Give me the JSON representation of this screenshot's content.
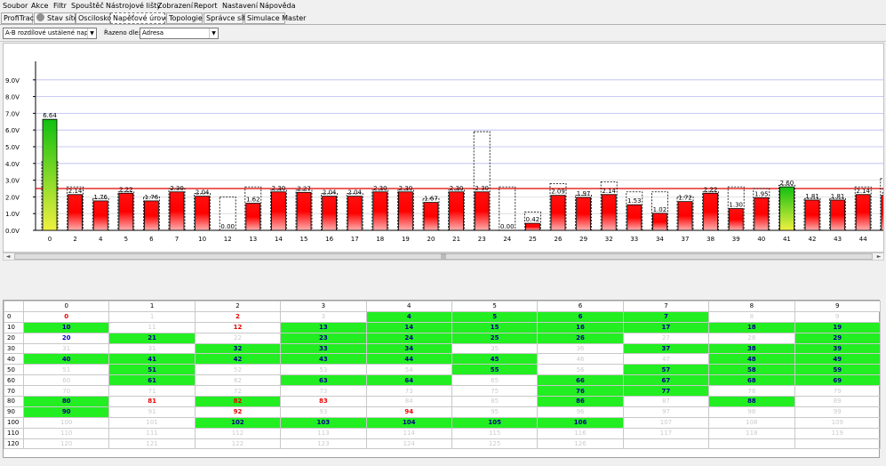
{
  "menu": [
    "Soubor",
    "Akce",
    "Filtr",
    "Spouštěč",
    "Nástrojové lišty",
    "Zobrazení",
    "Report",
    "Nastavení",
    "Nápověda"
  ],
  "tabs": [
    "ProfiTrace",
    "Stav sítě",
    "Osciloskop",
    "Napěťové úrovně",
    "Topologie",
    "Správce sítě",
    "Simulace Master"
  ],
  "toolbar": {
    "measure_value": "A-B rozdílové ustálené napětí",
    "sort_label": "Řazeno dle:",
    "sort_value": "Adresa"
  },
  "colors": {
    "bar_red": "#ff0000",
    "bar_green": "#00c000",
    "threshold_line": "#e00000",
    "grid_green": "#22ee22"
  },
  "chart_data": {
    "type": "bar",
    "ylabel": "",
    "ylim": [
      0,
      10
    ],
    "yticks": [
      "0.0V",
      "1.0V",
      "2.0V",
      "3.0V",
      "4.0V",
      "5.0V",
      "6.0V",
      "7.0V",
      "8.0V",
      "9.0V"
    ],
    "threshold": 2.5,
    "categories": [
      "0",
      "2",
      "4",
      "5",
      "6",
      "7",
      "10",
      "12",
      "13",
      "14",
      "15",
      "16",
      "17",
      "18",
      "19",
      "20",
      "21",
      "23",
      "24",
      "25",
      "26",
      "29",
      "32",
      "33",
      "34",
      "37",
      "38",
      "39",
      "40",
      "41",
      "42",
      "43",
      "44",
      "45"
    ],
    "values": [
      6.64,
      2.14,
      1.76,
      2.22,
      1.76,
      2.3,
      2.04,
      0.0,
      1.62,
      2.3,
      2.27,
      2.04,
      2.04,
      2.3,
      2.3,
      1.67,
      2.3,
      2.3,
      0.0,
      0.42,
      2.09,
      1.97,
      2.14,
      1.53,
      1.02,
      1.72,
      2.22,
      1.3,
      1.95,
      2.6,
      1.81,
      1.81,
      2.14,
      2.09
    ],
    "labels": [
      "6.64",
      "2.14",
      "1.76",
      "2.22",
      "1.76",
      "2.30",
      "2.04",
      "0.00",
      "1.62",
      "2.30",
      "2.27",
      "2.04",
      "2.04",
      "2.30",
      "2.30",
      "1.67",
      "2.30",
      "2.30",
      "0.00",
      "0.42",
      "2.09",
      "1.97",
      "2.14",
      "1.53",
      "1.02",
      "1.72",
      "2.22",
      "1.30",
      "1.95",
      "2.60",
      "1.81",
      "1.81",
      "2.14",
      "2.09"
    ],
    "peaks": [
      4.1,
      2.6,
      1.9,
      2.3,
      2.0,
      2.5,
      2.2,
      2.0,
      2.6,
      2.4,
      2.4,
      2.2,
      2.2,
      2.4,
      2.4,
      1.9,
      2.4,
      5.9,
      2.6,
      1.1,
      2.8,
      2.1,
      2.9,
      2.3,
      2.3,
      2.0,
      2.3,
      2.6,
      2.5,
      2.7,
      1.9,
      1.9,
      2.6,
      3.1
    ],
    "bar_colors": [
      "green",
      "red",
      "red",
      "red",
      "red",
      "red",
      "red",
      "red",
      "red",
      "red",
      "red",
      "red",
      "red",
      "red",
      "red",
      "red",
      "red",
      "red",
      "red",
      "red",
      "red",
      "red",
      "red",
      "red",
      "red",
      "red",
      "red",
      "red",
      "red",
      "green",
      "red",
      "red",
      "red",
      "red"
    ]
  },
  "grid": {
    "columns": [
      "0",
      "1",
      "2",
      "3",
      "4",
      "5",
      "6",
      "7",
      "8",
      "9"
    ],
    "rows": [
      {
        "head": "0",
        "cells": [
          [
            "0",
            "r"
          ],
          [
            "1",
            "w"
          ],
          [
            "2",
            "r"
          ],
          [
            "3",
            "w"
          ],
          [
            "4",
            "gb"
          ],
          [
            "5",
            "gb"
          ],
          [
            "6",
            "gb"
          ],
          [
            "7",
            "gb"
          ],
          [
            "8",
            "w"
          ],
          [
            "9",
            "w"
          ]
        ]
      },
      {
        "head": "10",
        "cells": [
          [
            "10",
            "gb"
          ],
          [
            "11",
            "w"
          ],
          [
            "12",
            "r"
          ],
          [
            "13",
            "gb"
          ],
          [
            "14",
            "gb"
          ],
          [
            "15",
            "gb"
          ],
          [
            "16",
            "gb"
          ],
          [
            "17",
            "gb"
          ],
          [
            "18",
            "gb"
          ],
          [
            "19",
            "gb"
          ]
        ]
      },
      {
        "head": "20",
        "cells": [
          [
            "20",
            "b"
          ],
          [
            "21",
            "gb"
          ],
          [
            "22",
            "w"
          ],
          [
            "23",
            "gb"
          ],
          [
            "24",
            "gb"
          ],
          [
            "25",
            "gb"
          ],
          [
            "26",
            "gb"
          ],
          [
            "27",
            "w"
          ],
          [
            "28",
            "w"
          ],
          [
            "29",
            "gb"
          ]
        ]
      },
      {
        "head": "30",
        "cells": [
          [
            "31",
            "w"
          ],
          [
            "31",
            "w"
          ],
          [
            "32",
            "gb"
          ],
          [
            "33",
            "gb"
          ],
          [
            "34",
            "gb"
          ],
          [
            "35",
            "w"
          ],
          [
            "36",
            "w"
          ],
          [
            "37",
            "gb"
          ],
          [
            "38",
            "gb"
          ],
          [
            "39",
            "gb"
          ]
        ]
      },
      {
        "head": "40",
        "cells": [
          [
            "40",
            "gb"
          ],
          [
            "41",
            "gb"
          ],
          [
            "42",
            "gb"
          ],
          [
            "43",
            "gb"
          ],
          [
            "44",
            "gb"
          ],
          [
            "45",
            "gb"
          ],
          [
            "46",
            "w"
          ],
          [
            "47",
            "w"
          ],
          [
            "48",
            "gb"
          ],
          [
            "49",
            "gb"
          ]
        ]
      },
      {
        "head": "50",
        "cells": [
          [
            "51",
            "w"
          ],
          [
            "51",
            "gb"
          ],
          [
            "52",
            "w"
          ],
          [
            "53",
            "w"
          ],
          [
            "54",
            "w"
          ],
          [
            "55",
            "gb"
          ],
          [
            "56",
            "w"
          ],
          [
            "57",
            "gb"
          ],
          [
            "58",
            "gb"
          ],
          [
            "59",
            "gb"
          ]
        ]
      },
      {
        "head": "60",
        "cells": [
          [
            "60",
            "w"
          ],
          [
            "61",
            "gb"
          ],
          [
            "62",
            "w"
          ],
          [
            "63",
            "gb"
          ],
          [
            "64",
            "gb"
          ],
          [
            "65",
            "w"
          ],
          [
            "66",
            "gb"
          ],
          [
            "67",
            "gb"
          ],
          [
            "68",
            "gb"
          ],
          [
            "69",
            "gb"
          ]
        ]
      },
      {
        "head": "70",
        "cells": [
          [
            "70",
            "w"
          ],
          [
            "71",
            "w"
          ],
          [
            "72",
            "w"
          ],
          [
            "73",
            "w"
          ],
          [
            "73",
            "w"
          ],
          [
            "75",
            "w"
          ],
          [
            "76",
            "gb"
          ],
          [
            "77",
            "gb"
          ],
          [
            "78",
            "w"
          ],
          [
            "79",
            "w"
          ]
        ]
      },
      {
        "head": "80",
        "cells": [
          [
            "80",
            "gb"
          ],
          [
            "81",
            "r"
          ],
          [
            "82",
            "gr"
          ],
          [
            "83",
            "r"
          ],
          [
            "84",
            "w"
          ],
          [
            "85",
            "w"
          ],
          [
            "86",
            "gb"
          ],
          [
            "87",
            "w"
          ],
          [
            "88",
            "gb"
          ],
          [
            "89",
            "w"
          ]
        ]
      },
      {
        "head": "90",
        "cells": [
          [
            "90",
            "gb"
          ],
          [
            "91",
            "w"
          ],
          [
            "92",
            "r"
          ],
          [
            "93",
            "w"
          ],
          [
            "94",
            "r"
          ],
          [
            "95",
            "w"
          ],
          [
            "96",
            "w"
          ],
          [
            "97",
            "w"
          ],
          [
            "98",
            "w"
          ],
          [
            "99",
            "w"
          ]
        ]
      },
      {
        "head": "100",
        "cells": [
          [
            "100",
            "w"
          ],
          [
            "101",
            "w"
          ],
          [
            "102",
            "gb"
          ],
          [
            "103",
            "gb"
          ],
          [
            "104",
            "gb"
          ],
          [
            "105",
            "gb"
          ],
          [
            "106",
            "gb"
          ],
          [
            "107",
            "w"
          ],
          [
            "108",
            "w"
          ],
          [
            "109",
            "w"
          ]
        ]
      },
      {
        "head": "110",
        "cells": [
          [
            "110",
            "w"
          ],
          [
            "111",
            "w"
          ],
          [
            "112",
            "w"
          ],
          [
            "113",
            "w"
          ],
          [
            "114",
            "w"
          ],
          [
            "115",
            "w"
          ],
          [
            "116",
            "w"
          ],
          [
            "117",
            "w"
          ],
          [
            "118",
            "w"
          ],
          [
            "119",
            "w"
          ]
        ]
      },
      {
        "head": "120",
        "cells": [
          [
            "120",
            "w"
          ],
          [
            "121",
            "w"
          ],
          [
            "122",
            "w"
          ],
          [
            "123",
            "w"
          ],
          [
            "124",
            "w"
          ],
          [
            "125",
            "w"
          ],
          [
            "126",
            "w"
          ],
          [
            "",
            "w"
          ],
          [
            "",
            "w"
          ],
          [
            "",
            "w"
          ]
        ]
      }
    ]
  }
}
